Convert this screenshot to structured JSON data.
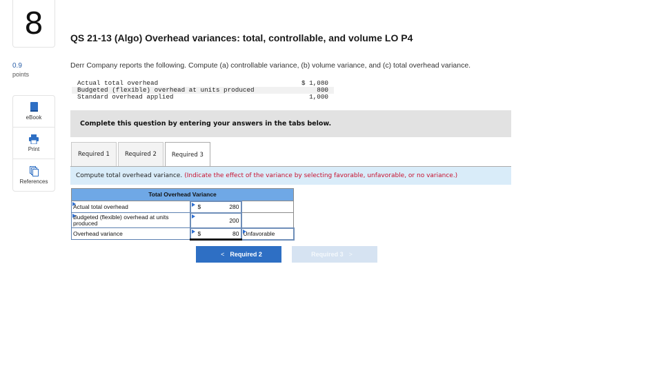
{
  "question": {
    "number": "8",
    "points_value": "0.9",
    "points_label": "points",
    "title": "QS 21-13 (Algo) Overhead variances: total, controllable, and volume LO P4",
    "intro": "Derr Company reports the following. Compute (a) controllable variance, (b) volume variance, and (c) total overhead variance.",
    "given": [
      {
        "label": "Actual total overhead",
        "amount": "$ 1,080"
      },
      {
        "label": "Budgeted (flexible) overhead at units produced",
        "amount": "800"
      },
      {
        "label": "Standard overhead applied",
        "amount": "1,000"
      }
    ]
  },
  "tools": [
    {
      "label": "eBook",
      "icon": "book-icon"
    },
    {
      "label": "Print",
      "icon": "printer-icon"
    },
    {
      "label": "References",
      "icon": "references-icon"
    }
  ],
  "complete_banner": "Complete this question by entering your answers in the tabs below.",
  "tabs": [
    {
      "label": "Required 1",
      "active": false
    },
    {
      "label": "Required 2",
      "active": false
    },
    {
      "label": "Required 3",
      "active": true
    }
  ],
  "instruction": {
    "main": "Compute total overhead variance.",
    "note": "(Indicate the effect of the variance by selecting favorable, unfavorable, or no variance.)"
  },
  "answer_table": {
    "title": "Total Overhead Variance",
    "rows": [
      {
        "label": "Actual total overhead",
        "dollar": "$",
        "value": "280",
        "result": ""
      },
      {
        "label": "Budgeted (flexible) overhead at units produced",
        "dollar": "",
        "value": "200",
        "result": ""
      },
      {
        "label": "Overhead variance",
        "dollar": "$",
        "value": "80",
        "result": "Unfavorable"
      }
    ]
  },
  "nav": {
    "prev_label": "Required 2",
    "next_label": "Required 3",
    "prev_chevron": "<",
    "next_chevron": ">"
  }
}
